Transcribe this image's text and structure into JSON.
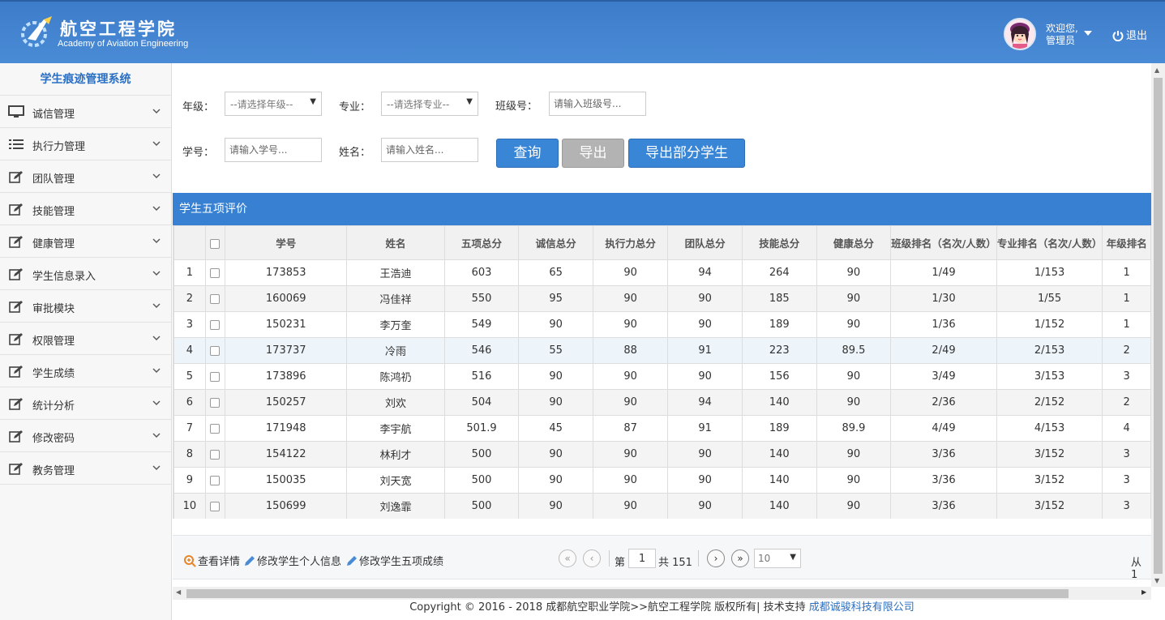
{
  "header": {
    "school_cn": "航空工程学院",
    "school_en": "Academy of Aviation Engineering",
    "welcome": "欢迎您,",
    "user": "管理员",
    "logout": "退出"
  },
  "sidebar": {
    "title": "学生痕迹管理系统",
    "items": [
      {
        "label": "诚信管理",
        "icon": "monitor-icon"
      },
      {
        "label": "执行力管理",
        "icon": "list-icon"
      },
      {
        "label": "团队管理",
        "icon": "edit-icon"
      },
      {
        "label": "技能管理",
        "icon": "edit-icon"
      },
      {
        "label": "健康管理",
        "icon": "edit-icon"
      },
      {
        "label": "学生信息录入",
        "icon": "edit-icon"
      },
      {
        "label": "审批模块",
        "icon": "edit-icon"
      },
      {
        "label": "权限管理",
        "icon": "edit-icon"
      },
      {
        "label": "学生成绩",
        "icon": "edit-icon"
      },
      {
        "label": "统计分析",
        "icon": "edit-icon"
      },
      {
        "label": "修改密码",
        "icon": "edit-icon"
      },
      {
        "label": "教务管理",
        "icon": "edit-icon"
      }
    ]
  },
  "filters": {
    "grade_label": "年级：",
    "grade_value": "--请选择年级--",
    "major_label": "专业：",
    "major_value": "--请选择专业--",
    "class_label": "班级号：",
    "class_placeholder": "请输入班级号...",
    "sid_label": "学号：",
    "sid_placeholder": "请输入学号...",
    "name_label": "姓名：",
    "name_placeholder": "请输入姓名...",
    "query": "查询",
    "export": "导出",
    "export_part": "导出部分学生"
  },
  "panel": {
    "title": "学生五项评价"
  },
  "table": {
    "headers": [
      "学号",
      "姓名",
      "五项总分",
      "诚信总分",
      "执行力总分",
      "团队总分",
      "技能总分",
      "健康总分",
      "班级排名（名次/人数）",
      "专业排名（名次/人数）",
      "年级排名"
    ],
    "rows": [
      [
        "1",
        "173853",
        "王浩迪",
        "603",
        "65",
        "90",
        "94",
        "264",
        "90",
        "1/49",
        "1/153",
        "1"
      ],
      [
        "2",
        "160069",
        "冯佳祥",
        "550",
        "95",
        "90",
        "90",
        "185",
        "90",
        "1/30",
        "1/55",
        "1"
      ],
      [
        "3",
        "150231",
        "李万奎",
        "549",
        "90",
        "90",
        "90",
        "189",
        "90",
        "1/36",
        "1/152",
        "1"
      ],
      [
        "4",
        "173737",
        "冷雨",
        "546",
        "55",
        "88",
        "91",
        "223",
        "89.5",
        "2/49",
        "2/153",
        "2"
      ],
      [
        "5",
        "173896",
        "陈鸿礽",
        "516",
        "90",
        "90",
        "90",
        "156",
        "90",
        "3/49",
        "3/153",
        "3"
      ],
      [
        "6",
        "150257",
        "刘欢",
        "504",
        "90",
        "90",
        "94",
        "140",
        "90",
        "2/36",
        "2/152",
        "2"
      ],
      [
        "7",
        "171948",
        "李宇航",
        "501.9",
        "45",
        "87",
        "91",
        "189",
        "89.9",
        "4/49",
        "4/153",
        "4"
      ],
      [
        "8",
        "154122",
        "林利才",
        "500",
        "90",
        "90",
        "90",
        "140",
        "90",
        "3/36",
        "3/152",
        "3"
      ],
      [
        "9",
        "150035",
        "刘天宽",
        "500",
        "90",
        "90",
        "90",
        "140",
        "90",
        "3/36",
        "3/152",
        "3"
      ],
      [
        "10",
        "150699",
        "刘逸霏",
        "500",
        "90",
        "90",
        "90",
        "140",
        "90",
        "3/36",
        "3/152",
        "3"
      ]
    ]
  },
  "toolbar": {
    "view": "查看详情",
    "edit_info": "修改学生个人信息",
    "edit_scores": "修改学生五项成绩"
  },
  "pager": {
    "page_prefix": "第",
    "page": "1",
    "total": "共 151",
    "page_size": "10",
    "range": "从 1"
  },
  "footer": {
    "text": "Copyright © 2016 - 2018 成都航空职业学院>>航空工程学院 版权所有| 技术支持 ",
    "link": "成都诚骏科技有限公司"
  },
  "colors": {
    "header": "#4a8bd6",
    "accent": "#3780d2",
    "button_blue": "#3a86d6",
    "button_gray": "#b3b3b3"
  }
}
